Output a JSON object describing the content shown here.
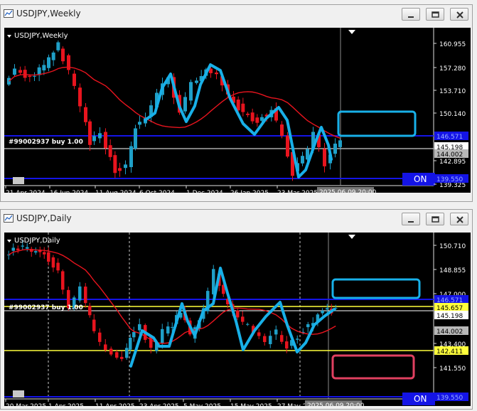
{
  "windows": [
    {
      "id": "weekly",
      "title": "USDJPY,Weekly",
      "label": "USDJPY,Weekly",
      "order_label": "#99002937 buy 1.00",
      "on_label": "ON",
      "date_axis": [
        "21 Apr 2024",
        "16 Jun 2024",
        "11 Aug 2024",
        "6 Oct 2024",
        "1 Dec 2024",
        "26 Jan 2025",
        "23 Mar 2025"
      ],
      "cursor_date": "2025.06.09 20:00",
      "price_axis": [
        "160.955",
        "157.280",
        "153.710",
        "150.140",
        "142.895",
        "139.325"
      ],
      "price_tags": [
        {
          "text": "146.571",
          "style": "blue"
        },
        {
          "text": "145.198",
          "style": "white"
        },
        {
          "text": "144.002",
          "style": "gray"
        },
        {
          "text": "139.550",
          "style": "blue"
        }
      ]
    },
    {
      "id": "daily",
      "title": "USDJPY,Daily",
      "label": "USDJPY,Daily",
      "order_label": "#99002937 buy 1.00",
      "on_label": "ON",
      "date_axis": [
        "20 Mar 2025",
        "1 Apr 2025",
        "11 Apr 2025",
        "23 Apr 2025",
        "5 May 2025",
        "15 May 2025",
        "27 May 2025"
      ],
      "cursor_date": "2025.06.09 20:00",
      "price_axis": [
        "150.710",
        "148.855",
        "147.000",
        "143.400",
        "141.550"
      ],
      "price_tags": [
        {
          "text": "146.571",
          "style": "blue"
        },
        {
          "text": "145.657",
          "style": "yellow"
        },
        {
          "text": "145.198",
          "style": "white"
        },
        {
          "text": "144.002",
          "style": "gray"
        },
        {
          "text": "142.411",
          "style": "yellow"
        },
        {
          "text": "139.550",
          "style": "blue"
        }
      ]
    }
  ],
  "colors": {
    "bull": "#1fa0c8",
    "bear": "#e8141e",
    "ma": "#e8141e",
    "drawing": "#18b0e8",
    "level": "#1414e6",
    "yellow": "#ffff3c",
    "box_blue": "#18b0e8",
    "box_red": "#e04060"
  }
}
